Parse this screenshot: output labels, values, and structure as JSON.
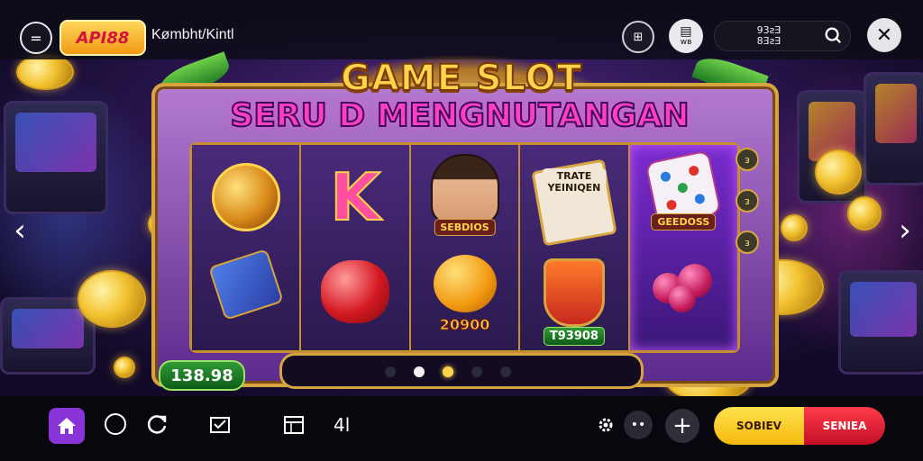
{
  "header": {
    "logo_text": "API88",
    "site_name": "Kømbht/Kintl",
    "grid_label": "⊞",
    "wallet_label": "ᴡʙ",
    "balance_line1": "93ƨƎ",
    "balance_line2": "8ƎƨƎ"
  },
  "game": {
    "title_line1": "GAME SLOT",
    "title_line2": "SERU D MENGNUTANGAN",
    "reels": {
      "r3_label": "SEBDIOS",
      "r4_label": "TRATE YEINIQEN",
      "r5_label": "GEEDOSS",
      "r3_bottom_label": "20900",
      "r4_bottom_label": "T93908"
    },
    "side_markers": [
      "ᴈ",
      "ᴈ",
      "ᴈ"
    ],
    "win_badge": "138.98",
    "pager": {
      "count": 5,
      "active_index": 2
    }
  },
  "nav": {
    "left_arrow": "‹",
    "right_arrow": "›"
  },
  "bottom": {
    "number_label": "4l",
    "cta_left": "SOBIEV",
    "cta_right": "SENIEA"
  },
  "colors": {
    "accent_purple": "#8a33d8",
    "cta_yellow": "#f4b90c",
    "cta_red": "#d41a2c",
    "title_gold": "#ffd34a",
    "title_pink": "#ff3fc0"
  }
}
